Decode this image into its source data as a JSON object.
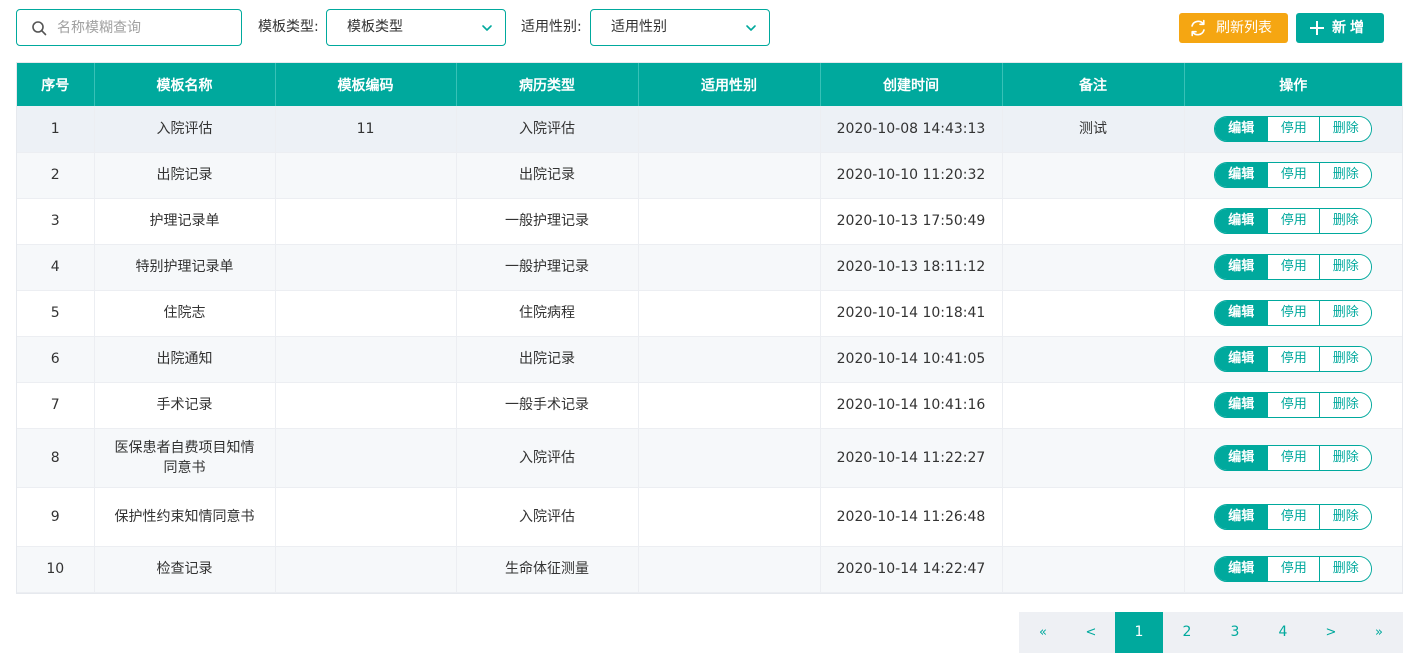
{
  "toolbar": {
    "search_placeholder": "名称模糊查询",
    "template_type_label": "模板类型:",
    "template_type_value": "模板类型",
    "gender_label": "适用性别:",
    "gender_value": "适用性别",
    "refresh_label": "刷新列表",
    "add_label": "新增"
  },
  "table": {
    "headers": [
      "序号",
      "模板名称",
      "模板编码",
      "病历类型",
      "适用性别",
      "创建时间",
      "备注",
      "操作"
    ],
    "actions": {
      "edit": "编辑",
      "disable": "停用",
      "delete": "删除"
    },
    "rows": [
      {
        "no": "1",
        "name": "入院评估",
        "code": "11",
        "type": "入院评估",
        "gender": "",
        "created": "2020-10-08 14:43:13",
        "remark": "测试"
      },
      {
        "no": "2",
        "name": "出院记录",
        "code": "",
        "type": "出院记录",
        "gender": "",
        "created": "2020-10-10 11:20:32",
        "remark": ""
      },
      {
        "no": "3",
        "name": "护理记录单",
        "code": "",
        "type": "一般护理记录",
        "gender": "",
        "created": "2020-10-13 17:50:49",
        "remark": ""
      },
      {
        "no": "4",
        "name": "特别护理记录单",
        "code": "",
        "type": "一般护理记录",
        "gender": "",
        "created": "2020-10-13 18:11:12",
        "remark": ""
      },
      {
        "no": "5",
        "name": "住院志",
        "code": "",
        "type": "住院病程",
        "gender": "",
        "created": "2020-10-14 10:18:41",
        "remark": ""
      },
      {
        "no": "6",
        "name": "出院通知",
        "code": "",
        "type": "出院记录",
        "gender": "",
        "created": "2020-10-14 10:41:05",
        "remark": ""
      },
      {
        "no": "7",
        "name": "手术记录",
        "code": "",
        "type": "一般手术记录",
        "gender": "",
        "created": "2020-10-14 10:41:16",
        "remark": ""
      },
      {
        "no": "8",
        "name": "医保患者自费项目知情同意书",
        "code": "",
        "type": "入院评估",
        "gender": "",
        "created": "2020-10-14 11:22:27",
        "remark": ""
      },
      {
        "no": "9",
        "name": "保护性约束知情同意书",
        "code": "",
        "type": "入院评估",
        "gender": "",
        "created": "2020-10-14 11:26:48",
        "remark": ""
      },
      {
        "no": "10",
        "name": "检查记录",
        "code": "",
        "type": "生命体征测量",
        "gender": "",
        "created": "2020-10-14 14:22:47",
        "remark": ""
      }
    ]
  },
  "pagination": {
    "first": "«",
    "prev": "<",
    "pages": [
      "1",
      "2",
      "3",
      "4"
    ],
    "current": "1",
    "next": ">",
    "last": "»"
  },
  "colors": {
    "primary": "#00a99d",
    "warning": "#f5a612"
  },
  "icons": {
    "search": "search-icon",
    "dropdown": "chevron-down-icon",
    "refresh": "refresh-icon",
    "add": "plus-icon"
  }
}
